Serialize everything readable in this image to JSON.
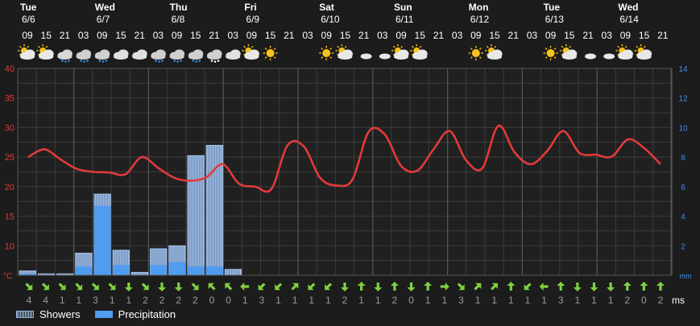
{
  "chart_data": {
    "type": "line",
    "days": [
      {
        "weekday": "Tue",
        "date": "6/6"
      },
      {
        "weekday": "Wed",
        "date": "6/7"
      },
      {
        "weekday": "Thu",
        "date": "6/8"
      },
      {
        "weekday": "Fri",
        "date": "6/9"
      },
      {
        "weekday": "Sat",
        "date": "6/10"
      },
      {
        "weekday": "Sun",
        "date": "6/11"
      },
      {
        "weekday": "Mon",
        "date": "6/12"
      },
      {
        "weekday": "Tue",
        "date": "6/13"
      },
      {
        "weekday": "Wed",
        "date": "6/14"
      }
    ],
    "hours": [
      "09",
      "15",
      "21",
      "03",
      "09",
      "15",
      "21",
      "03",
      "09",
      "15",
      "21",
      "03",
      "09",
      "15",
      "21",
      "03",
      "09",
      "15",
      "21",
      "03",
      "09",
      "15",
      "21",
      "03",
      "09",
      "15",
      "21",
      "03",
      "09",
      "15",
      "21",
      "03",
      "09",
      "15",
      "21"
    ],
    "icons": [
      "sun-cloud-icon",
      "sun-cloud-icon",
      "moon-cloud-rain-icon",
      "rain-cloud-icon",
      "rain-cloud-icon",
      "cloud-icon",
      "cloud-icon",
      "rain-cloud-icon",
      "rain-cloud-icon",
      "rain-cloud-icon",
      "snow-cloud-icon",
      "cloud-icon",
      "sun-cloud-icon",
      "sun-icon",
      "moon-icon",
      "moon-icon",
      "sun-icon",
      "sun-cloud-icon",
      "moon-cloud-icon",
      "moon-cloud-icon",
      "sun-cloud-icon",
      "sun-cloud-icon",
      "moon-icon",
      "moon-icon",
      "sun-icon",
      "sun-cloud-icon",
      "moon-icon",
      "moon-icon",
      "sun-icon",
      "sun-cloud-icon",
      "moon-cloud-icon",
      "moon-cloud-icon",
      "sun-cloud-icon",
      "sun-cloud-icon",
      "moon-icon"
    ],
    "temp_unit": "°C",
    "precip_unit": "mm",
    "wind_unit": "ms",
    "y_left": {
      "min": 5,
      "max": 40,
      "ticks": [
        40,
        35,
        30,
        25,
        20,
        15,
        10
      ]
    },
    "y_right": {
      "min": 0,
      "max": 14,
      "ticks": [
        14,
        12,
        10,
        8,
        6,
        4,
        2
      ]
    },
    "temperature": [
      25,
      26.3,
      24.6,
      23,
      22.5,
      22.4,
      22.1,
      25,
      23.2,
      21.5,
      21,
      21.6,
      23.8,
      20.5,
      20,
      19.6,
      27,
      26.8,
      21.5,
      20.2,
      21.2,
      29.3,
      28.8,
      23.5,
      22.7,
      26.3,
      29.4,
      24.5,
      23.1,
      30.3,
      25.8,
      23.8,
      26,
      29.4,
      25.7,
      25.4,
      25.1,
      28,
      26.5,
      23.8
    ],
    "precipitation": [
      0.1,
      0,
      0,
      0.6,
      4.7,
      0.7,
      0,
      0.7,
      0.9,
      0.6,
      0.6,
      0,
      0
    ],
    "showers": [
      0.3,
      0.1,
      0.1,
      1.5,
      5.5,
      1.7,
      0.2,
      1.8,
      2.0,
      8.1,
      8.8,
      0.4,
      0
    ],
    "wind_speed": [
      "4",
      "4",
      "1",
      "1",
      "3",
      "1",
      "1",
      "2",
      "2",
      "2",
      "2",
      "0",
      "0",
      "1",
      "3",
      "1",
      "1",
      "1",
      "1",
      "2",
      "1",
      "1",
      "2",
      "0",
      "1",
      "1",
      "3",
      "1",
      "1",
      "1",
      "1",
      "1",
      "3",
      "1",
      "1",
      "1",
      "2",
      "0",
      "2"
    ],
    "wind_dir": [
      "se",
      "se",
      "se",
      "se",
      "se",
      "se",
      "s",
      "se",
      "s",
      "s",
      "se",
      "nw",
      "nw",
      "w",
      "sw",
      "sw",
      "ne",
      "sw",
      "sw",
      "s",
      "n",
      "s",
      "n",
      "s",
      "n",
      "e",
      "se",
      "ne",
      "ne",
      "n",
      "sw",
      "w",
      "n",
      "s",
      "s",
      "s",
      "n",
      "n",
      "n"
    ],
    "legend": [
      {
        "label": "Showers",
        "color": "#a9c8ee"
      },
      {
        "label": "Precipitation",
        "color": "#4f9cf0"
      }
    ],
    "colors": {
      "temperature": "#e23a3a",
      "precipitation": "#4f9cf0",
      "showers": "#a9c8ee",
      "left_axis": "#e23a3a",
      "right_axis": "#3f8cf0",
      "wind_arrow": "#7fd13f",
      "wind_text": "#9a9a9a",
      "grid": "#3c3c3c"
    }
  }
}
